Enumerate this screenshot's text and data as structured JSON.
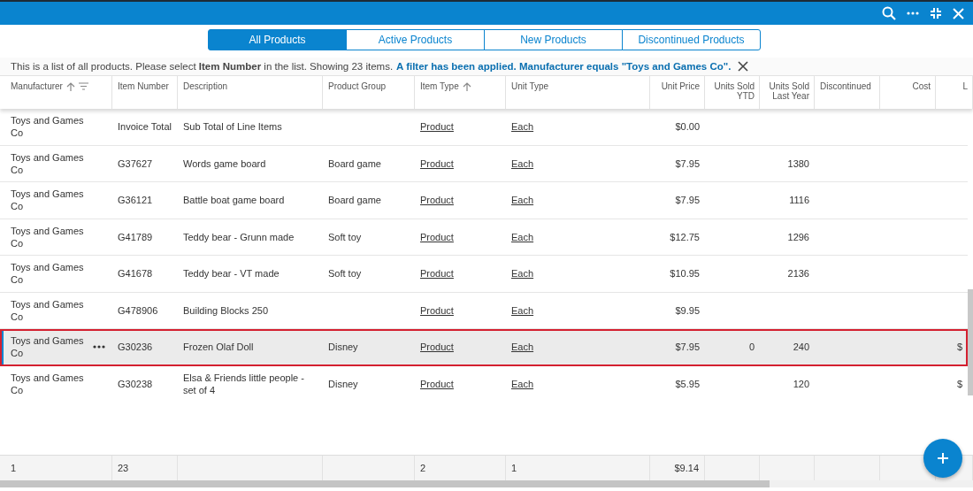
{
  "tabs": [
    {
      "label": "All Products",
      "selected": true
    },
    {
      "label": "Active Products",
      "selected": false
    },
    {
      "label": "New Products",
      "selected": false
    },
    {
      "label": "Discontinued Products",
      "selected": false
    }
  ],
  "info": {
    "text": "This is a list of all products. Please select **Item Number** in the list. Showing 23 items.",
    "filter_link": "A filter has been applied. Manufacturer equals \"Toys and Games Co\"."
  },
  "table": {
    "columns": [
      {
        "label": "Manufacturer",
        "kind": "text",
        "sorted_ascending": true,
        "filter": true,
        "total": "1"
      },
      {
        "label": "Item Number",
        "kind": "text",
        "total": "23"
      },
      {
        "label": "Description",
        "kind": "text"
      },
      {
        "label": "Product Group",
        "kind": "text"
      },
      {
        "label": "Item Type",
        "kind": "link",
        "sorted_ascending": true,
        "total": "2"
      },
      {
        "label": "Unit Type",
        "kind": "link",
        "total": "1"
      },
      {
        "label": "Unit Price",
        "kind": "number",
        "total": "$9.14"
      },
      {
        "label": "Units Sold YTD",
        "kind": "number"
      },
      {
        "label": "Units Sold Last Year",
        "kind": "number"
      },
      {
        "label": "Discontinued",
        "kind": "text"
      },
      {
        "label": "Cost",
        "kind": "number"
      },
      {
        "label": "L",
        "kind": "number"
      }
    ],
    "rows": [
      {
        "selected": false,
        "manufacturer": "Toys and Games Co",
        "item_number": "Invoice Total",
        "description": "Sub Total of Line Items",
        "item_type": "Product",
        "unit_type": "Each",
        "unit_price": "$0.00"
      },
      {
        "selected": false,
        "manufacturer": "Toys and Games Co",
        "item_number": "G37627",
        "description": "Words game board",
        "product_group": "Board game",
        "item_type": "Product",
        "unit_type": "Each",
        "unit_price": "$7.95",
        "units_sold_last_year": "1380"
      },
      {
        "selected": false,
        "manufacturer": "Toys and Games Co",
        "item_number": "G36121",
        "description": "Battle boat game board",
        "product_group": "Board game",
        "item_type": "Product",
        "unit_type": "Each",
        "unit_price": "$7.95",
        "units_sold_last_year": "1116"
      },
      {
        "selected": false,
        "manufacturer": "Toys and Games Co",
        "item_number": "G41789",
        "description": "Teddy bear - Grunn made",
        "product_group": "Soft toy",
        "item_type": "Product",
        "unit_type": "Each",
        "unit_price": "$12.75",
        "units_sold_last_year": "1296"
      },
      {
        "selected": false,
        "manufacturer": "Toys and Games Co",
        "item_number": "G41678",
        "description": "Teddy bear - VT made",
        "product_group": "Soft toy",
        "item_type": "Product",
        "unit_type": "Each",
        "unit_price": "$10.95",
        "units_sold_last_year": "2136"
      },
      {
        "selected": false,
        "manufacturer": "Toys and Games Co",
        "item_number": "G478906",
        "description": "Building Blocks 250",
        "item_type": "Product",
        "unit_type": "Each",
        "unit_price": "$9.95"
      },
      {
        "selected": true,
        "manufacturer": "Toys and Games Co",
        "item_number": "G30236",
        "description": "Frozen Olaf Doll",
        "product_group": "Disney",
        "item_type": "Product",
        "unit_type": "Each",
        "unit_price": "$7.95",
        "units_sold_ytd": "0",
        "units_sold_last_year": "240",
        "column_12": "$"
      },
      {
        "selected": false,
        "manufacturer": "Toys and Games Co",
        "item_number": "G30238",
        "description": "Elsa & Friends little people - set of 4",
        "product_group": "Disney",
        "item_type": "Product",
        "unit_type": "Each",
        "unit_price": "$5.95",
        "units_sold_last_year": "120",
        "column_12": "$"
      }
    ]
  }
}
